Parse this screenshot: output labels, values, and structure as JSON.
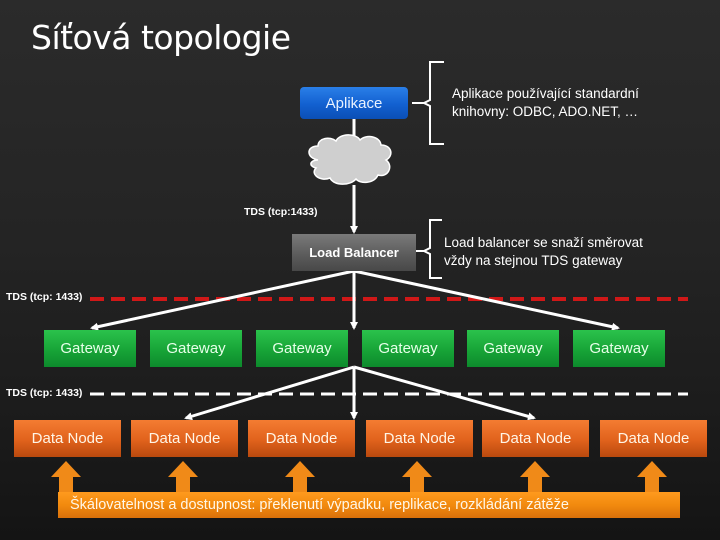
{
  "title": "Síťová topologie",
  "application": {
    "label": "Aplikace",
    "note_lines": [
      "Aplikace používající standardní",
      "knihovny: ODBC, ADO.NET, …"
    ]
  },
  "network": {
    "icon": "cloud-icon"
  },
  "tds_top_label": "TDS (tcp:1433)",
  "load_balancer": {
    "label": "Load Balancer",
    "note_lines": [
      "Load balancer se snaží směrovat",
      "vždy na stejnou TDS gateway"
    ]
  },
  "boundaries": [
    {
      "label": "TDS (tcp: 1433)",
      "style": "dashed",
      "color": "#d01818"
    },
    {
      "label": "TDS (tcp: 1433)",
      "style": "dashed",
      "color": "#ffffff"
    }
  ],
  "gateways": [
    {
      "label": "Gateway"
    },
    {
      "label": "Gateway"
    },
    {
      "label": "Gateway"
    },
    {
      "label": "Gateway"
    },
    {
      "label": "Gateway"
    },
    {
      "label": "Gateway"
    }
  ],
  "data_nodes": [
    {
      "label": "Data Node"
    },
    {
      "label": "Data Node"
    },
    {
      "label": "Data Node"
    },
    {
      "label": "Data Node"
    },
    {
      "label": "Data Node"
    },
    {
      "label": "Data Node"
    }
  ],
  "banner": {
    "label": "Škálovatelnost a dostupnost: překlenutí výpadku, replikace, rozkládání zátěže"
  },
  "connections": {
    "lb_to_gateways": [
      0,
      2,
      5
    ],
    "gateway3_to_data_nodes": [
      1,
      2,
      4
    ]
  },
  "colors": {
    "application": "#1563d4",
    "load_balancer": "#5e5e5e",
    "gateway": "#17a437",
    "data_node": "#e0621c",
    "banner": "#f28a0e",
    "red_boundary": "#d01818",
    "background": "#232323"
  }
}
